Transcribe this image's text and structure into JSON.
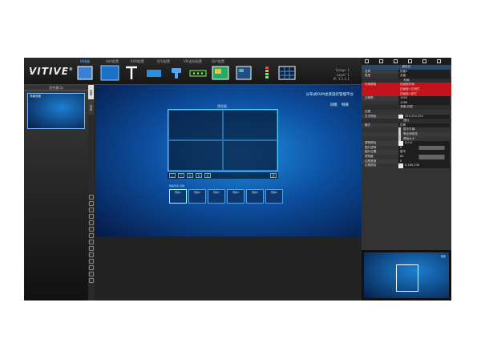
{
  "app": {
    "logo": "VITIVE",
    "logo_mark": "®"
  },
  "menu_tabs": [
    {
      "label": "拼接器"
    },
    {
      "label": "协作配置"
    },
    {
      "label": "KVM配置"
    },
    {
      "label": "信号配置"
    },
    {
      "label": "VR/虚拟配置"
    },
    {
      "label": "用户配置"
    }
  ],
  "toolbar_tools": [
    {
      "name": "screen-tool-icon",
      "color": "#3a7fd0"
    },
    {
      "name": "background-tool-icon",
      "color": "#1e6fc8"
    },
    {
      "name": "text-tool-icon",
      "color": "#ffffff"
    },
    {
      "name": "window-tool-icon",
      "color": "#2a8fdf"
    },
    {
      "name": "signal-tool-icon",
      "color": "#4aa8ff"
    },
    {
      "name": "device-tool-icon",
      "color": "#80ff60"
    },
    {
      "name": "image-tool-icon",
      "color": "#f0c040"
    },
    {
      "name": "layout-tool-icon",
      "color": "#6ab"
    },
    {
      "name": "meter-tool-icon",
      "color": "#5f5"
    },
    {
      "name": "grid-tool-icon",
      "color": "#4a90e2"
    }
  ],
  "status": {
    "group": "Group: 1",
    "layer": "Layer: 1",
    "ip": "IP: 1.1.1.1"
  },
  "left_panel": {
    "header": "页列表(1)",
    "thumb_label": "场景页面"
  },
  "vtabs": [
    {
      "label": "页面"
    },
    {
      "label": "场景"
    }
  ],
  "canvas": {
    "title": "分布式KVM坐席操控管理平台",
    "sub": "同端 畅联",
    "preview_label": "预览窗",
    "preset_label": "预案列表  切换",
    "presets": [
      {
        "label": "预案1"
      },
      {
        "label": "预案2"
      },
      {
        "label": "预案3"
      },
      {
        "label": "预案4"
      },
      {
        "label": "预案5"
      },
      {
        "label": "预案6"
      }
    ],
    "pbtns": [
      "上",
      "下",
      "左",
      "右",
      "全",
      "退"
    ]
  },
  "properties": [
    {
      "k": "",
      "v": "属性页",
      "type": "head"
    },
    {
      "k": "名称",
      "v": "页面1",
      "type": "field"
    },
    {
      "k": "类型",
      "v": "页面",
      "type": "field"
    },
    {
      "k": "",
      "v": "布局",
      "type": "sect"
    },
    {
      "k": "布局模板",
      "v": "四画面布局",
      "type": "red"
    },
    {
      "k": "",
      "v": "四画面+左侧栏",
      "type": "red"
    },
    {
      "k": "",
      "v": "四画面+底栏",
      "type": "red"
    },
    {
      "k": "分辨率",
      "v": "1920",
      "type": "field"
    },
    {
      "k": "",
      "v": "1080",
      "type": "field"
    },
    {
      "k": "",
      "v": "背景/边框",
      "type": "sect"
    },
    {
      "k": "边框",
      "v": "",
      "type": "field"
    },
    {
      "k": "文字颜色",
      "v": "255,255,255",
      "type": "color"
    },
    {
      "k": "",
      "v": "图片",
      "type": "sect"
    },
    {
      "k": "模式",
      "v": "拉伸",
      "type": "field"
    },
    {
      "k": "",
      "v": "居中平铺",
      "type": "check"
    },
    {
      "k": "",
      "v": "等比例填充",
      "type": "check"
    },
    {
      "k": "",
      "v": "原始大小",
      "type": "check"
    },
    {
      "k": "透明颜色",
      "v": "0,0,0",
      "type": "color"
    },
    {
      "k": "图片透明",
      "v": "0",
      "type": "slider"
    },
    {
      "k": "图片位置",
      "v": "居中",
      "type": "field"
    },
    {
      "k": "透明度",
      "v": "80",
      "type": "slider"
    },
    {
      "k": "边框宽度",
      "v": "0",
      "type": "field"
    },
    {
      "k": "边框颜色",
      "v": "0,160,230",
      "type": "color"
    }
  ],
  "mini_preview": {
    "caption": "预览"
  }
}
